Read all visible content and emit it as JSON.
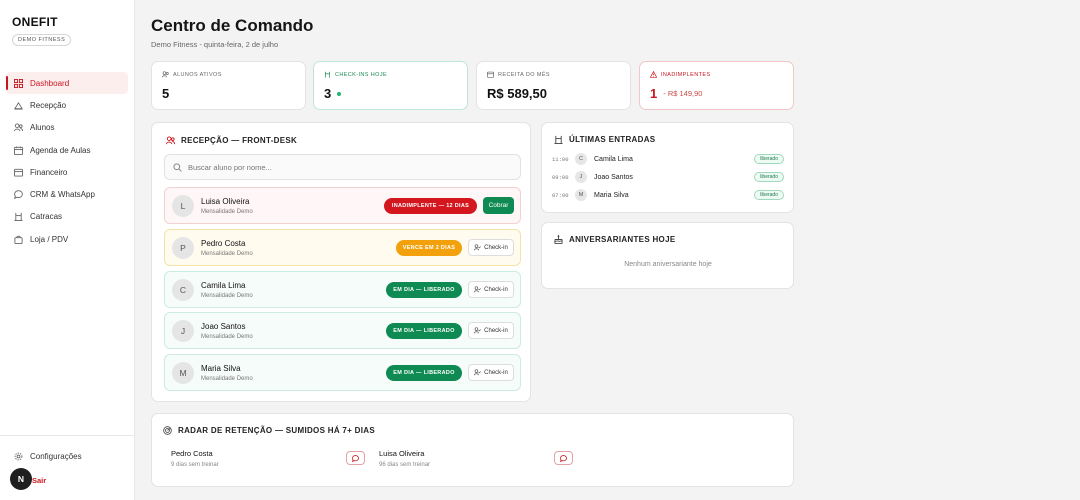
{
  "brand": {
    "logo": "ONEFIT",
    "org": "DEMO FITNESS"
  },
  "colors": {
    "accent": "#c9151e",
    "success": "#0f8a52",
    "warning": "#f2a10c"
  },
  "sidebar": {
    "items": [
      {
        "label": "Dashboard",
        "icon": "grid-icon",
        "active": true
      },
      {
        "label": "Recepção",
        "icon": "reception-icon"
      },
      {
        "label": "Alunos",
        "icon": "users-icon"
      },
      {
        "label": "Agenda de Aulas",
        "icon": "calendar-icon"
      },
      {
        "label": "Financeiro",
        "icon": "wallet-icon"
      },
      {
        "label": "CRM & WhatsApp",
        "icon": "chat-icon"
      },
      {
        "label": "Catracas",
        "icon": "turnstile-icon"
      },
      {
        "label": "Loja / PDV",
        "icon": "bag-icon"
      }
    ],
    "settings": "Configurações",
    "user_initial": "N",
    "logout": "Sair"
  },
  "header": {
    "title": "Centro de Comando",
    "subtitle": "Demo Fitness - quinta-feira, 2 de julho"
  },
  "stats": {
    "active": {
      "label": "ALUNOS ATIVOS",
      "value": "5"
    },
    "checkins": {
      "label": "CHECK-INS HOJE",
      "value": "3"
    },
    "revenue": {
      "label": "RECEITA DO MÊS",
      "value": "R$ 589,50"
    },
    "defaulters": {
      "label": "INADIMPLENTES",
      "value": "1",
      "amount": "- R$ 149,90"
    }
  },
  "reception": {
    "title": "RECEPÇÃO — FRONT-DESK",
    "search_placeholder": "Buscar aluno por nome...",
    "members": [
      {
        "initial": "L",
        "name": "Luisa Oliveira",
        "plan": "Mensalidade Demo",
        "status": "INADIMPLENTE — 12 DIAS",
        "action": "Cobrar"
      },
      {
        "initial": "P",
        "name": "Pedro Costa",
        "plan": "Mensalidade Demo",
        "status": "VENCE EM 2 DIAS",
        "action": "Check-in"
      },
      {
        "initial": "C",
        "name": "Camila Lima",
        "plan": "Mensalidade Demo",
        "status": "EM DIA — LIBERADO",
        "action": "Check-in"
      },
      {
        "initial": "J",
        "name": "Joao Santos",
        "plan": "Mensalidade Demo",
        "status": "EM DIA — LIBERADO",
        "action": "Check-in"
      },
      {
        "initial": "M",
        "name": "Maria Silva",
        "plan": "Mensalidade Demo",
        "status": "EM DIA — LIBERADO",
        "action": "Check-in"
      }
    ]
  },
  "entries": {
    "title": "ÚLTIMAS ENTRADAS",
    "items": [
      {
        "time": "11:00",
        "initial": "C",
        "name": "Camila Lima",
        "status": "liberado"
      },
      {
        "time": "09:00",
        "initial": "J",
        "name": "Joao Santos",
        "status": "liberado"
      },
      {
        "time": "07:00",
        "initial": "M",
        "name": "Maria Silva",
        "status": "liberado"
      }
    ]
  },
  "birthdays": {
    "title": "ANIVERSARIANTES HOJE",
    "empty": "Nenhum aniversariante hoje"
  },
  "radar": {
    "title": "RADAR DE RETENÇÃO — SUMIDOS HÁ 7+ DIAS",
    "items": [
      {
        "name": "Pedro Costa",
        "detail": "9 dias sem treinar"
      },
      {
        "name": "Luisa Oliveira",
        "detail": "96 dias sem treinar"
      }
    ]
  }
}
